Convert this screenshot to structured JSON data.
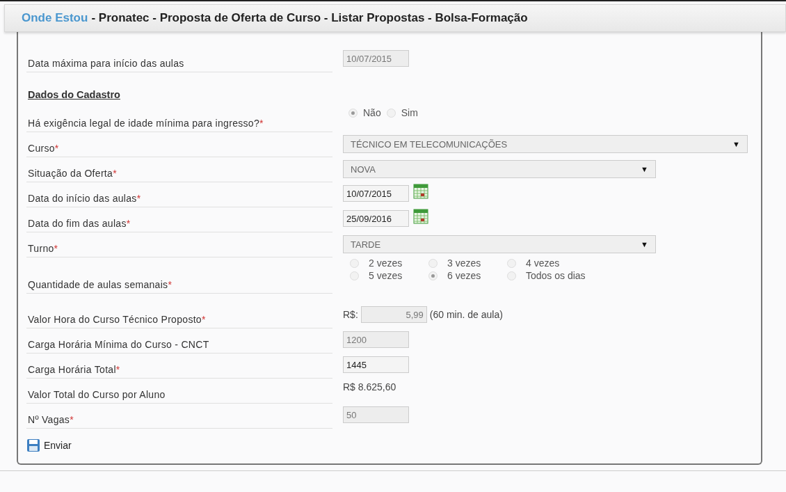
{
  "breadcrumb": {
    "link": "Onde Estou",
    "path": "- Pronatec - Proposta de Oferta de Curso - Listar Propostas - Bolsa-Formação"
  },
  "top_rows": [
    {
      "kind": "input",
      "label": "Data máxima para início das aulas",
      "value": "10/07/2015",
      "disabled": true
    }
  ],
  "section_title": "Dados do Cadastro",
  "rows": [
    {
      "kind": "radio",
      "label": "Há exigência legal de idade mínima para ingresso?",
      "marker": "*",
      "options": [
        {
          "label": "Não",
          "selected": true
        },
        {
          "label": "Sim",
          "selected": false
        }
      ]
    },
    {
      "kind": "wide_select",
      "label": "Curso",
      "marker": "*",
      "value": "TÉCNICO EM TELECOMUNICAÇÕES",
      "arrow": "▼"
    },
    {
      "kind": "select",
      "label": "Situação da Oferta",
      "marker": "*",
      "value": "NOVA",
      "arrow": "▼"
    },
    {
      "kind": "date",
      "label": "Data do início das aulas",
      "marker": "*",
      "value": "10/07/2015",
      "disabled": false
    },
    {
      "kind": "date",
      "label": "Data do fim das aulas",
      "marker": "*",
      "value": "25/09/2016",
      "disabled": false
    },
    {
      "kind": "select",
      "label": "Turno",
      "marker": "*",
      "value": "TARDE",
      "arrow": "▼"
    },
    {
      "kind": "radio_grid",
      "label": "Quantidade de aulas semanais",
      "marker": "*",
      "options": [
        {
          "label": "2 vezes",
          "selected": false
        },
        {
          "label": "3 vezes",
          "selected": false
        },
        {
          "label": "4 vezes",
          "selected": false
        },
        {
          "label": "5 vezes",
          "selected": false
        },
        {
          "label": "6 vezes",
          "selected": true
        },
        {
          "label": "Todos os dias",
          "selected": false
        }
      ]
    },
    {
      "kind": "money",
      "label": "Valor Hora do Curso Técnico Proposto",
      "marker": "*",
      "prefix": "R$:",
      "value": "5,99",
      "suffix": "(60 min. de aula)"
    },
    {
      "kind": "input",
      "label": "Carga Horária Mínima do Curso - CNCT",
      "value": "1200",
      "disabled": true
    },
    {
      "kind": "input",
      "label": "Carga Horária Total",
      "marker": "*",
      "value": "1445",
      "disabled": false
    },
    {
      "kind": "text",
      "label": "Valor Total do Curso por Aluno",
      "value": "R$ 8.625,60"
    },
    {
      "kind": "input",
      "label": "Nº Vagas",
      "marker": "*",
      "value": "50",
      "disabled": true
    }
  ],
  "submit": {
    "label": "Enviar"
  }
}
